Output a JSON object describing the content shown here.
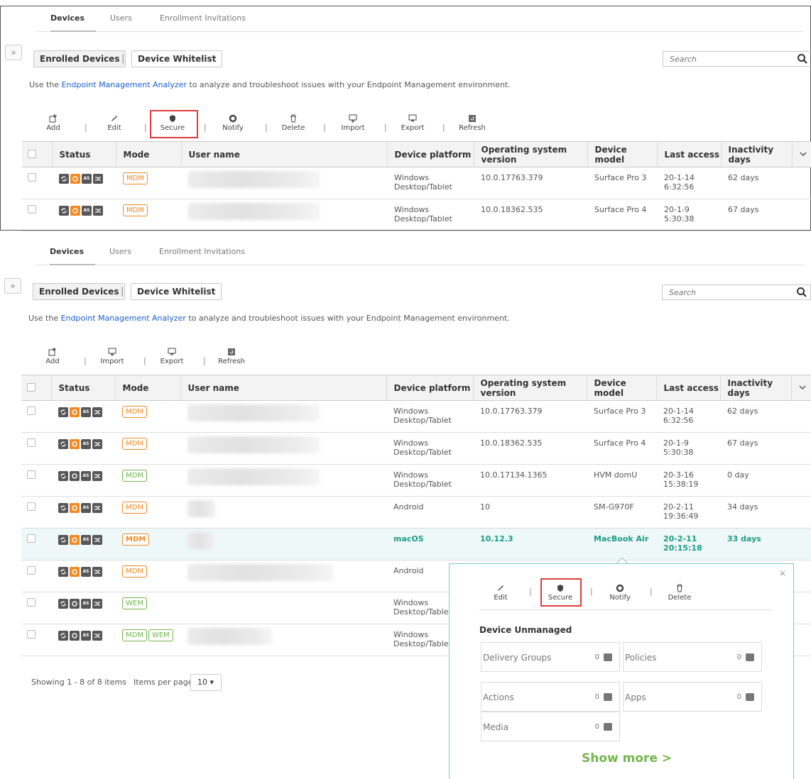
{
  "tabs": [
    "Devices",
    "Users",
    "Enrollment Invitations"
  ],
  "expand_glyph": "»",
  "segments": {
    "enrolled": "Enrolled Devices",
    "separator": "|",
    "whitelist": "Device Whitelist"
  },
  "search": {
    "placeholder": "Search"
  },
  "analyzer": {
    "before": "Use the ",
    "link": "Endpoint Management Analyzer",
    "after": " to analyze and troubleshoot issues with your Endpoint Management environment."
  },
  "toolbar_top": [
    "Add",
    "Edit",
    "Secure",
    "Notify",
    "Delete",
    "Import",
    "Export",
    "Refresh"
  ],
  "toolbar_bottom": [
    "Add",
    "Import",
    "Export",
    "Refresh"
  ],
  "toolbar_separator": "|",
  "columns": [
    "Status",
    "Mode",
    "User name",
    "Device platform",
    "Operating system version",
    "Device model",
    "Last access",
    "Inactivity days"
  ],
  "rows": [
    {
      "mode": [
        "MDM"
      ],
      "mode_color": "orange",
      "platform": "Windows Desktop/Tablet",
      "os": "10.0.17763.379",
      "model": "Surface Pro 3",
      "last_access": "20-1-14 6:32:56",
      "inactivity": "62 days",
      "status_orange": true
    },
    {
      "mode": [
        "MDM"
      ],
      "mode_color": "orange",
      "platform": "Windows Desktop/Tablet",
      "os": "10.0.18362.535",
      "model": "Surface Pro 4",
      "last_access": "20-1-9 5:30:38",
      "inactivity": "67 days",
      "status_orange": true
    },
    {
      "mode": [
        "MDM"
      ],
      "mode_color": "green",
      "platform": "Windows Desktop/Tablet",
      "os": "10.0.17134.1365",
      "model": "HVM domU",
      "last_access": "20-3-16 15:38:19",
      "inactivity": "0 day",
      "status_orange": false
    },
    {
      "mode": [
        "MDM"
      ],
      "mode_color": "orange",
      "platform": "Android",
      "os": "10",
      "model": "SM-G970F",
      "last_access": "20-2-11 19:36:49",
      "inactivity": "34 days",
      "status_orange": true
    },
    {
      "mode": [
        "MDM"
      ],
      "mode_color": "orange",
      "platform": "macOS",
      "os": "10.12.3",
      "model": "MacBook Air",
      "last_access": "20-2-11 20:15:18",
      "inactivity": "33 days",
      "status_orange": true,
      "selected": true
    },
    {
      "mode": [
        "MDM"
      ],
      "mode_color": "orange",
      "platform": "Android",
      "os": "",
      "model": "",
      "last_access": "",
      "inactivity": "",
      "status_orange": true
    },
    {
      "mode": [
        "WEM"
      ],
      "mode_color": "green",
      "platform": "Windows Desktop/Tablet",
      "os": "",
      "model": "",
      "last_access": "",
      "inactivity": "",
      "status_orange": false
    },
    {
      "mode": [
        "MDM",
        "WEM"
      ],
      "mode_color": "green",
      "platform": "Windows Desktop/Tablet",
      "os": "",
      "model": "",
      "last_access": "",
      "inactivity": "",
      "status_orange": false
    }
  ],
  "status_icons": [
    "sync-icon",
    "power-icon",
    "as-icon",
    "shuffle-icon"
  ],
  "status_as_text": "AS",
  "footer": {
    "showing": "Showing 1 - 8 of 8 items",
    "items_per_page": "Items per page:",
    "per_page_value": "10 ▾"
  },
  "popup": {
    "close": "×",
    "actions": [
      "Edit",
      "Secure",
      "Notify",
      "Delete"
    ],
    "title": "Device Unmanaged",
    "cells": [
      {
        "label": "Delivery Groups",
        "count": "0"
      },
      {
        "label": "Policies",
        "count": "0"
      },
      {
        "label": "Actions",
        "count": "0"
      },
      {
        "label": "Apps",
        "count": "0"
      },
      {
        "label": "Media",
        "count": "0"
      }
    ],
    "show_more": "Show more >"
  },
  "colors": {
    "link": "#1a5fd0",
    "orange": "#f08a24",
    "green": "#71b64c",
    "teal": "#1e9b86",
    "highlight": "#e23b3b"
  }
}
